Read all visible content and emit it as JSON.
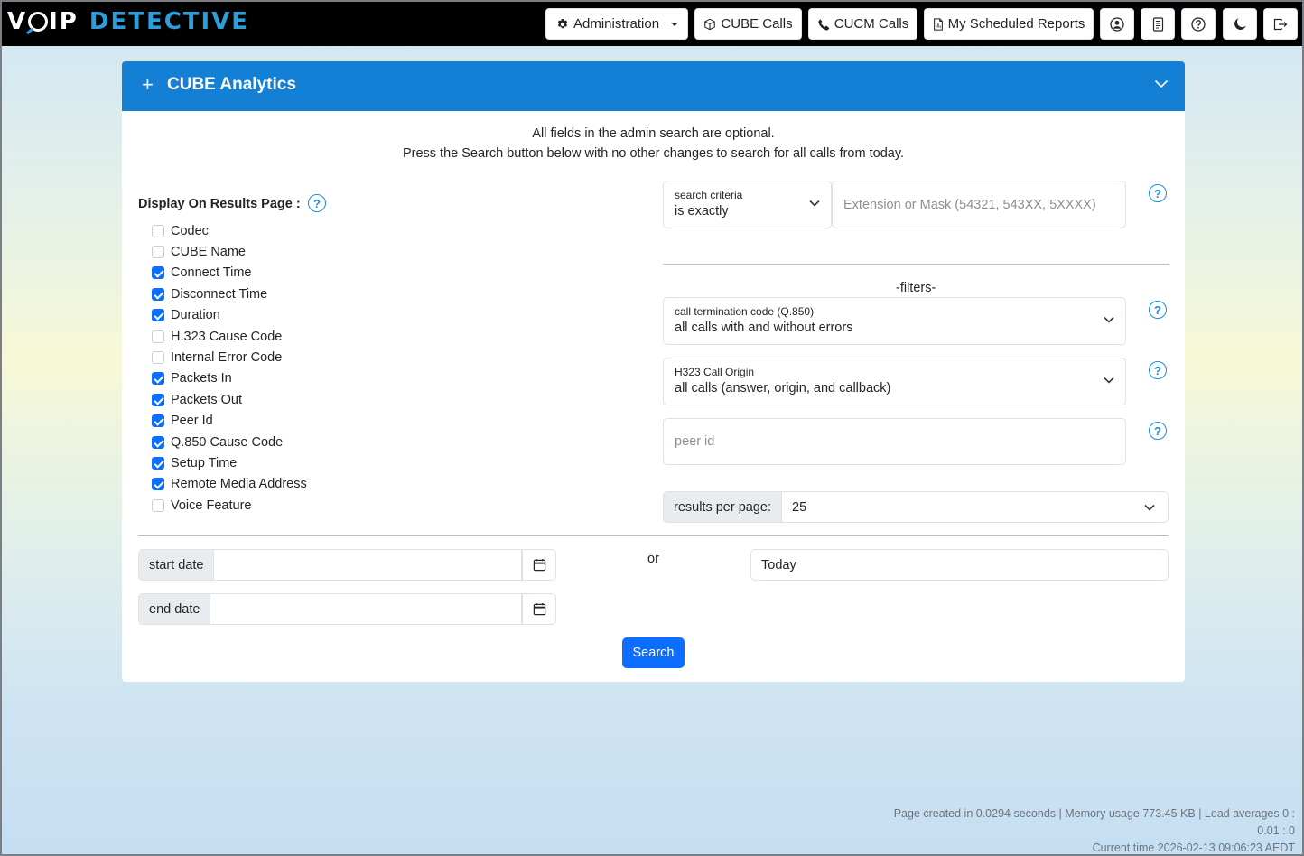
{
  "app": {
    "logo_white_1": "V",
    "logo_white_2": "IP",
    "logo_blue": "DETECTIVE"
  },
  "nav": {
    "administration": "Administration",
    "cube_calls": "CUBE Calls",
    "cucm_calls": "CUCM Calls",
    "scheduled_reports": "My Scheduled Reports"
  },
  "card": {
    "plus": "+",
    "title": "CUBE Analytics",
    "intro_line1": "All fields in the admin search are optional.",
    "intro_line2": "Press the Search button below with no other changes to search for all calls from today."
  },
  "display": {
    "label": "Display On Results Page :",
    "help": "?",
    "options": [
      {
        "label": "Codec",
        "checked": false
      },
      {
        "label": "CUBE Name",
        "checked": false
      },
      {
        "label": "Connect Time",
        "checked": true
      },
      {
        "label": "Disconnect Time",
        "checked": true
      },
      {
        "label": "Duration",
        "checked": true
      },
      {
        "label": "H.323 Cause Code",
        "checked": false
      },
      {
        "label": "Internal Error Code",
        "checked": false
      },
      {
        "label": "Packets In",
        "checked": true
      },
      {
        "label": "Packets Out",
        "checked": true
      },
      {
        "label": "Peer Id",
        "checked": true
      },
      {
        "label": "Q.850 Cause Code",
        "checked": true
      },
      {
        "label": "Setup Time",
        "checked": true
      },
      {
        "label": "Remote Media Address",
        "checked": true
      },
      {
        "label": "Voice Feature",
        "checked": false
      }
    ]
  },
  "search": {
    "criteria_label": "search criteria",
    "criteria_value": "is exactly",
    "extension_placeholder": "Extension or Mask (54321, 543XX, 5XXXX)"
  },
  "filters": {
    "heading": "-filters-",
    "termination_label": "call termination code (Q.850)",
    "termination_value": "all calls with and without errors",
    "origin_label": "H323 Call Origin",
    "origin_value": "all calls (answer, origin, and callback)",
    "peer_placeholder": "peer id",
    "results_label": "results per page:",
    "results_value": "25"
  },
  "dates": {
    "start_label": "start date",
    "end_label": "end date",
    "or": "or",
    "today": "Today"
  },
  "search_button": "Search",
  "footer": {
    "line1": "Page created in 0.0294 seconds | Memory usage 773.45 KB | Load averages 0 :",
    "line2": "0.01 : 0",
    "line3": "Current time 2026-02-13 09:06:23 AEDT"
  }
}
